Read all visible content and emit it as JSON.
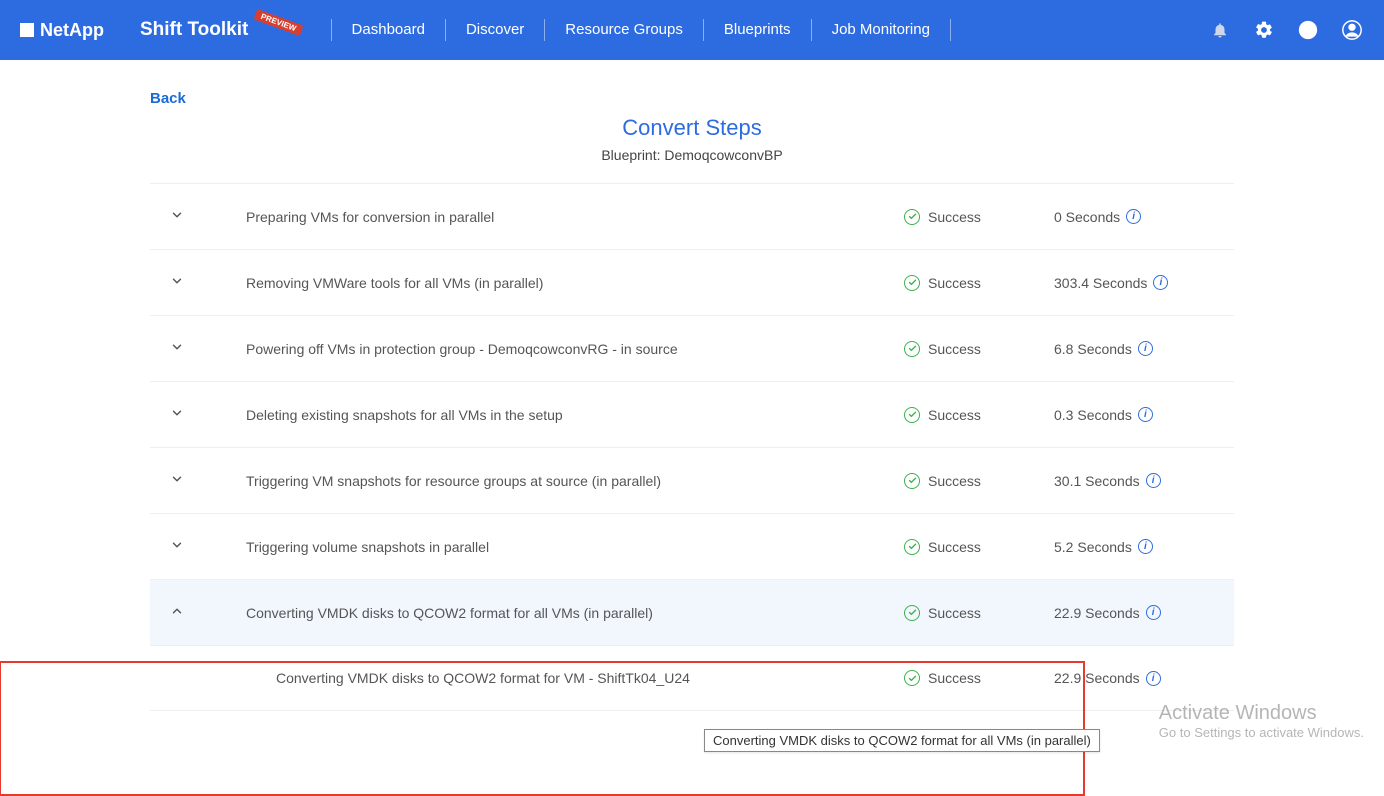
{
  "brand": "NetApp",
  "product": "Shift Toolkit",
  "preview_badge": "PREVIEW",
  "nav": [
    "Dashboard",
    "Discover",
    "Resource Groups",
    "Blueprints",
    "Job Monitoring"
  ],
  "back_label": "Back",
  "page_title": "Convert Steps",
  "blueprint_label": "Blueprint: DemoqcowconvBP",
  "success_label": "Success",
  "steps": [
    {
      "desc": "Preparing VMs for conversion in parallel",
      "status": "Success",
      "duration": "0 Seconds",
      "expanded": false
    },
    {
      "desc": "Removing VMWare tools for all VMs (in parallel)",
      "status": "Success",
      "duration": "303.4 Seconds",
      "expanded": false
    },
    {
      "desc": "Powering off VMs in protection group - DemoqcowconvRG - in source",
      "status": "Success",
      "duration": "6.8 Seconds",
      "expanded": false
    },
    {
      "desc": "Deleting existing snapshots for all VMs in the setup",
      "status": "Success",
      "duration": "0.3 Seconds",
      "expanded": false
    },
    {
      "desc": "Triggering VM snapshots for resource groups at source (in parallel)",
      "status": "Success",
      "duration": "30.1 Seconds",
      "expanded": false
    },
    {
      "desc": "Triggering volume snapshots in parallel",
      "status": "Success",
      "duration": "5.2 Seconds",
      "expanded": false
    },
    {
      "desc": "Converting VMDK disks to QCOW2 format for all VMs (in parallel)",
      "status": "Success",
      "duration": "22.9 Seconds",
      "expanded": true,
      "children": [
        {
          "desc": "Converting VMDK disks to QCOW2 format for VM - ShiftTk04_U24",
          "status": "Success",
          "duration": "22.9 Seconds"
        }
      ]
    }
  ],
  "tooltip_text": "Converting VMDK disks to QCOW2 format for all VMs (in parallel)",
  "watermark": {
    "title": "Activate Windows",
    "sub": "Go to Settings to activate Windows."
  }
}
